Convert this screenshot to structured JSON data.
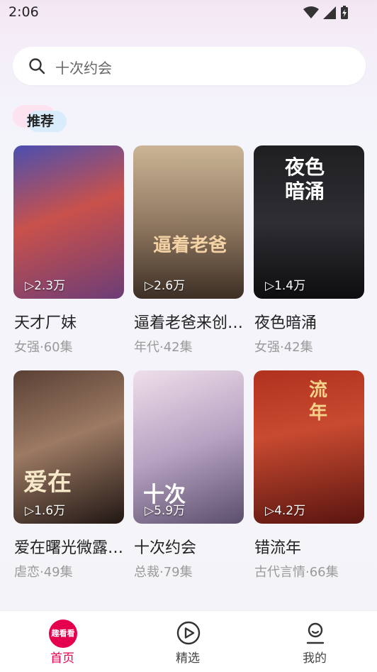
{
  "status_bar": {
    "time": "2:06"
  },
  "search": {
    "placeholder": "十次约会"
  },
  "section": {
    "label": "推荐"
  },
  "cards": [
    {
      "title": "天才厂妹",
      "meta": "女强·60集",
      "views": "▷2.3万",
      "colors": [
        "#3a3f8f",
        "#c9514b",
        "#6c3d77"
      ]
    },
    {
      "title": "逼着老爸来创…",
      "meta": "年代·42集",
      "views": "▷2.6万",
      "colors": [
        "#b59a78",
        "#7a6652",
        "#3d2f25"
      ],
      "poster_text": "逼着老爸"
    },
    {
      "title": "夜色暗涌",
      "meta": "女强·42集",
      "views": "▷1.4万",
      "colors": [
        "#1a1a1d",
        "#2f2f33",
        "#0e0e10"
      ],
      "poster_text": "夜色暗涌"
    },
    {
      "title": "爱在曙光微露…",
      "meta": "虐恋·49集",
      "views": "▷1.6万",
      "colors": [
        "#3b2a25",
        "#8c6a55",
        "#211714"
      ],
      "poster_text": "爱在"
    },
    {
      "title": "十次约会",
      "meta": "总裁·79集",
      "views": "▷5.9万",
      "colors": [
        "#e9d7e4",
        "#b7a2c2",
        "#5b4f6b"
      ],
      "poster_text": "十次"
    },
    {
      "title": "错流年",
      "meta": "古代言情·66集",
      "views": "▷4.2万",
      "colors": [
        "#9a2a1f",
        "#c84a30",
        "#5a1510"
      ],
      "poster_text": "流年"
    }
  ],
  "tabbar": {
    "items": [
      {
        "label": "首页",
        "logo": "趣看看",
        "active": true
      },
      {
        "label": "精选",
        "icon": "play-circle-icon"
      },
      {
        "label": "我的",
        "icon": "user-icon"
      }
    ]
  }
}
